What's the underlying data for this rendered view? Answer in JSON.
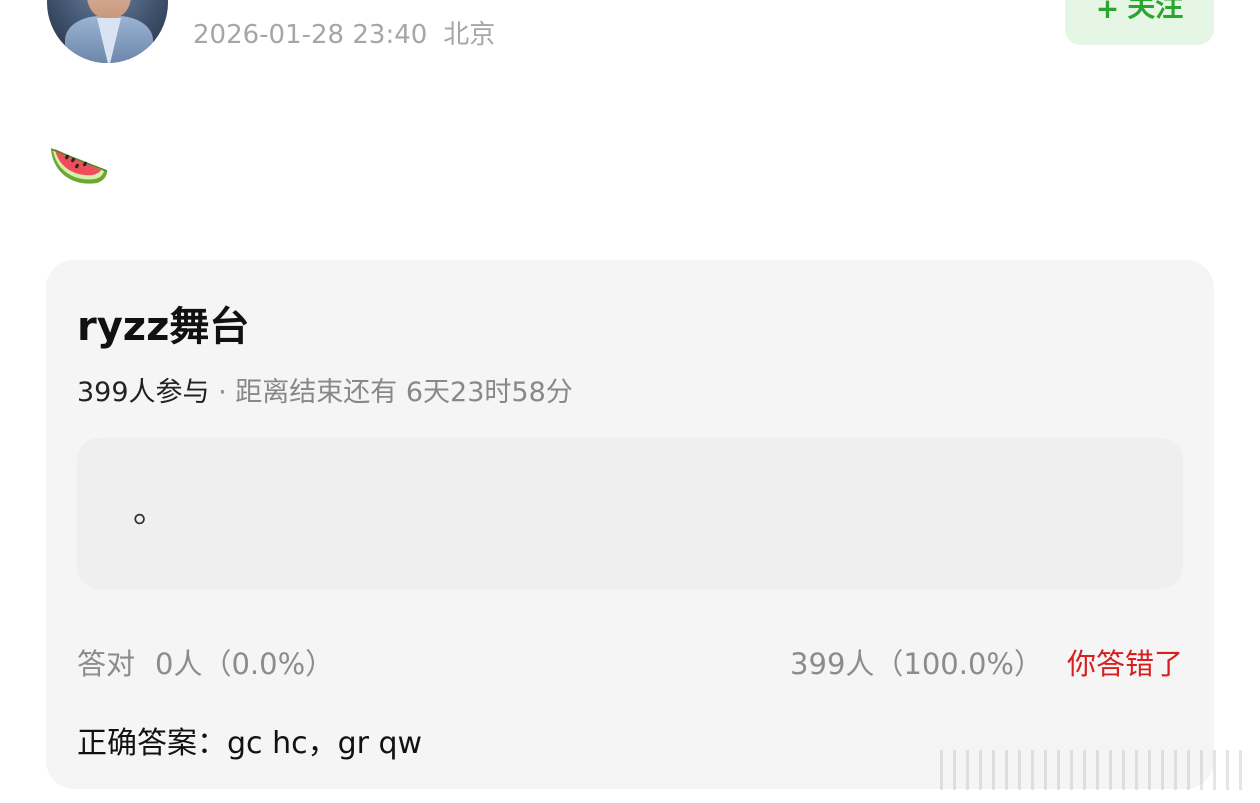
{
  "post": {
    "timestamp": "2026-01-28 23:40",
    "location": "北京",
    "follow_plus": "+",
    "follow_label": "关注",
    "emoji": "watermelon"
  },
  "card": {
    "title": "ryzz舞台",
    "participants": "399人参与",
    "separator": " · ",
    "countdown": "距离结束还有 6天23时58分",
    "answer_text": "。",
    "correct_label": "答对",
    "correct_count": "0人（0.0%）",
    "wrong_count": "399人（100.0%）",
    "wrong_status": "你答错了",
    "correct_answer": "正确答案：gc hc，gr qw"
  },
  "colors": {
    "follow_bg": "#e6f6e5",
    "follow_text": "#2aa52f",
    "wrong_text": "#d61f1f",
    "card_bg": "#f5f5f5"
  }
}
